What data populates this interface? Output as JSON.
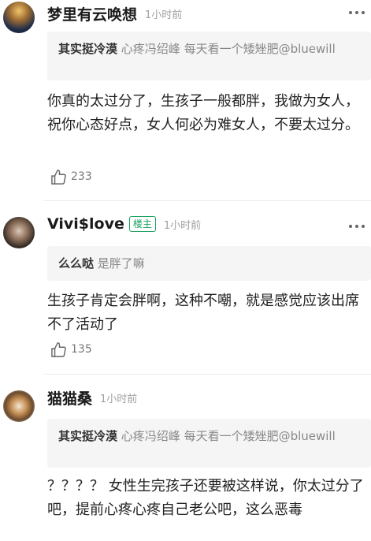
{
  "comments": [
    {
      "username": "梦里有云唤想",
      "time": "1小时前",
      "quote_user": "其实挺冷漠",
      "quote_text": "心疼冯绍峰 每天看一个矮矬肥@bluewill",
      "body": "你真的太过分了，生孩子一般都胖，我做为女人，祝你心态好点，女人何必为难女人，不要太过分。",
      "likes": "233"
    },
    {
      "username": "Vivi$love",
      "badge": "楼主",
      "time": "1小时前",
      "quote_user": "么么哒",
      "quote_text": "是胖了嘛",
      "body": "生孩子肯定会胖啊，这种不嘲，就是感觉应该出席不了活动了",
      "likes": "135"
    },
    {
      "username": "猫猫桑",
      "time": "1小时前",
      "quote_user": "其实挺冷漠",
      "quote_text": "心疼冯绍峰 每天看一个矮矬肥@bluewill",
      "body": "？？？？ 女性生完孩子还要被这样说，你太过分了吧，提前心疼心疼自己老公吧，这么恶毒"
    }
  ],
  "icons": {
    "like": "thumbs-up-icon",
    "more": "more-dots-icon"
  },
  "colors": {
    "badge": "#1aa260",
    "meta": "#a0a0a0",
    "quote_bg": "#f5f5f5"
  }
}
